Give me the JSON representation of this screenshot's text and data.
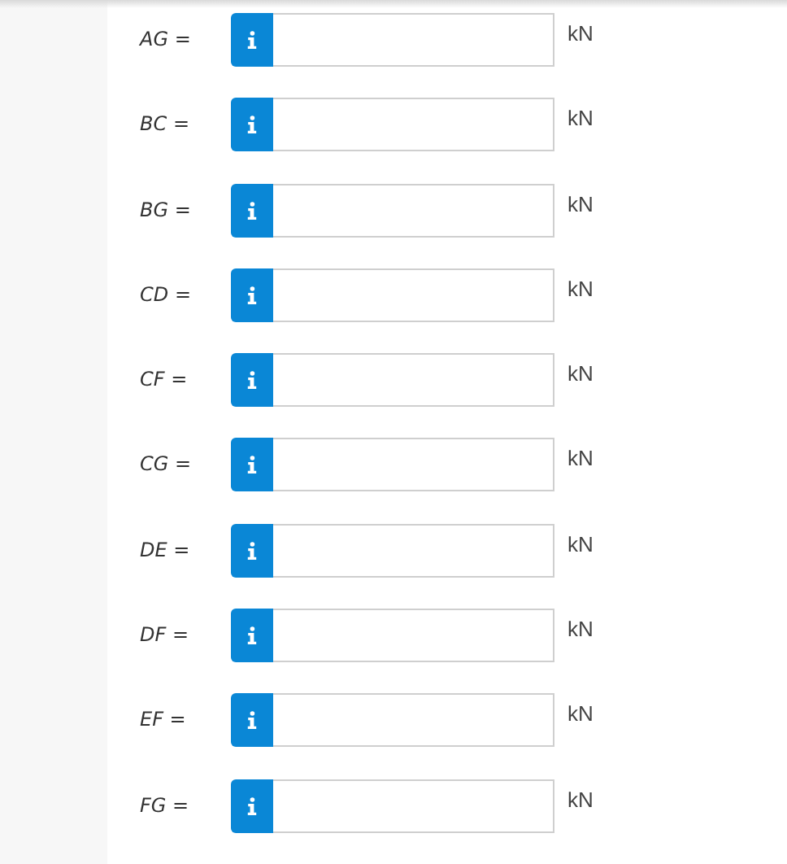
{
  "answers": [
    {
      "label": "*AG* =",
      "unit": "kN"
    },
    {
      "label": "*BC* =",
      "unit": "kN"
    },
    {
      "label": "*BG* =",
      "unit": "kN"
    },
    {
      "label": "*CD* =",
      "unit": "kN"
    },
    {
      "label": "*CF* =",
      "unit": "kN"
    },
    {
      "label": "*CG* =",
      "unit": "kN"
    },
    {
      "label": "*DE* =",
      "unit": "kN"
    },
    {
      "label": "*DF* =",
      "unit": "kN"
    },
    {
      "label": "*EF* =",
      "unit": "kN"
    },
    {
      "label": "*FG* =",
      "unit": "kN"
    }
  ]
}
